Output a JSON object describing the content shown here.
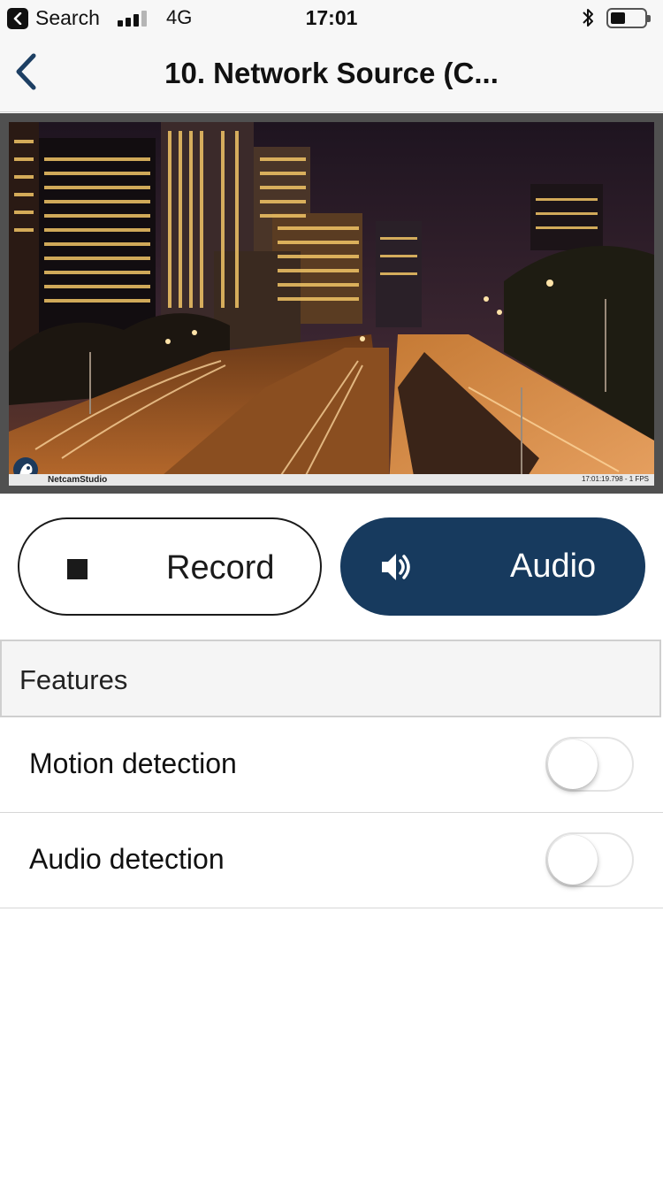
{
  "status_bar": {
    "back_app_label": "Search",
    "network": "4G",
    "time": "17:01",
    "signal_bars_filled": 3,
    "signal_bars_total": 4,
    "battery_level": 0.45
  },
  "nav": {
    "title": "10. Network Source (C..."
  },
  "video": {
    "brand": "NetcamStudio",
    "timestamp": "17:01:19.798 - 1 FPS"
  },
  "controls": {
    "record_label": "Record",
    "audio_label": "Audio"
  },
  "features": {
    "header": "Features",
    "items": [
      {
        "label": "Motion detection",
        "enabled": false
      },
      {
        "label": "Audio detection",
        "enabled": false
      }
    ]
  },
  "colors": {
    "accent": "#173a5e",
    "nav_back": "#1d3f63"
  }
}
